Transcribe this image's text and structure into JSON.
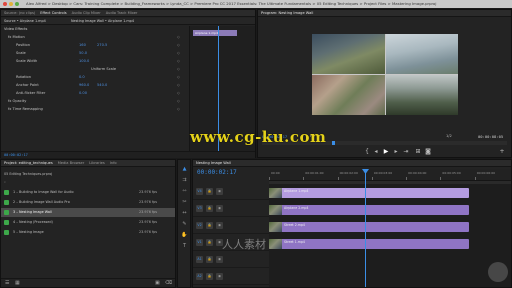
{
  "window": {
    "title": "Alex Alfred > Desktop > Cars: Training Complete > Building_Frameworks > Lynda_CC > Premiere Pro CC 2017 Essentials: The Ultimate Fundamentals > 05 Editing Techniques > Project Files > Mastering Image.prproj"
  },
  "effect_controls": {
    "tabs": [
      "Source: (no clips)",
      "Effect Controls",
      "Audio Clip Mixer",
      "Audio Track Mixer"
    ],
    "header_left": "Source • Airplane 1.mp4",
    "header_right": "Nesting Image Wall • Airplane 1.mp4",
    "section_label": "Video Effects",
    "rows": [
      {
        "label": "fx  Motion",
        "value": "",
        "value2": "",
        "indent": 1
      },
      {
        "label": "Position",
        "value": "160",
        "value2": "270.5",
        "indent": 3
      },
      {
        "label": "Scale",
        "value": "50.0",
        "value2": "",
        "indent": 3
      },
      {
        "label": "Scale Width",
        "value": "100.0",
        "value2": "",
        "indent": 3
      },
      {
        "label": "",
        "value": "Uniform Scale",
        "value2": "",
        "indent": 6
      },
      {
        "label": "Rotation",
        "value": "0.0",
        "value2": "",
        "indent": 3
      },
      {
        "label": "Anchor Point",
        "value": "960.0",
        "value2": "540.0",
        "indent": 3
      },
      {
        "label": "Anti-flicker Filter",
        "value": "0.00",
        "value2": "",
        "indent": 3
      },
      {
        "label": "fx  Opacity",
        "value": "",
        "value2": "",
        "indent": 1
      },
      {
        "label": "fx  Time Remapping",
        "value": "",
        "value2": "",
        "indent": 1
      }
    ],
    "clip_label": "Airplane 1.mp4",
    "timecode": "00:00:02:17"
  },
  "program": {
    "tab": "Program: Nesting Image Wall",
    "timecode_left": "00:00:02:17",
    "fit": "Fit",
    "scale": "1/2",
    "timecode_right": "00:00:08:05"
  },
  "project": {
    "tabs": [
      "Project: editing_techniques",
      "Media Browser",
      "Libraries",
      "Info"
    ],
    "project_name": "05 Editing Techniques.prproj",
    "items": [
      {
        "name": "1 – Building to Image Wall for Audio",
        "dur": "23.976 fps",
        "selected": false
      },
      {
        "name": "2 – Building Image Wall Audio Pro",
        "dur": "23.976 fps",
        "selected": false
      },
      {
        "name": "3 – Nesting Image Wall",
        "dur": "23.976 fps",
        "selected": true
      },
      {
        "name": "4 – Nesting (Processed)",
        "dur": "23.976 fps",
        "selected": false
      },
      {
        "name": "5 – Nesting Image",
        "dur": "23.976 fps",
        "selected": false
      }
    ]
  },
  "timeline": {
    "tab": "Nesting Image Wall",
    "timecode": "00:00:02:17",
    "ruler": [
      "00:00",
      "00:00:01:00",
      "00:00:02:00",
      "00:00:03:00",
      "00:00:04:00",
      "00:00:05:00",
      "00:00:06:00"
    ],
    "tracks": [
      "V4",
      "V3",
      "V2",
      "V1",
      "A1",
      "A2"
    ],
    "clips": [
      {
        "label": "Airplane 1.mp4"
      },
      {
        "label": "Airplane 2.mp4"
      },
      {
        "label": "Street 2.mp4"
      },
      {
        "label": "Street 1.mp4"
      }
    ]
  },
  "watermark": {
    "main": "www.cg-ku.com",
    "brand": "人人素材"
  },
  "colors": {
    "accent": "#3b8ee6",
    "clip": "#b49ce0",
    "clip_dark": "#8f74c4",
    "watermark": "#e5d21a"
  }
}
